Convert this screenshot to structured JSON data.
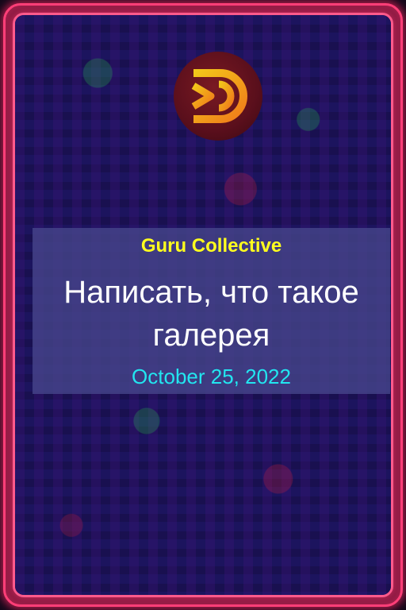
{
  "card": {
    "author": "Guru Collective",
    "title": "Написать, что такое галерея",
    "date": "October 25, 2022"
  },
  "logo": {
    "icon": "d-monogram-logo-icon"
  },
  "colors": {
    "frame_border": "#ff3f78",
    "author_text": "#ffff1e",
    "title_text": "#ffffff",
    "date_text": "#22e6f0",
    "panel_background": "#46468c"
  }
}
